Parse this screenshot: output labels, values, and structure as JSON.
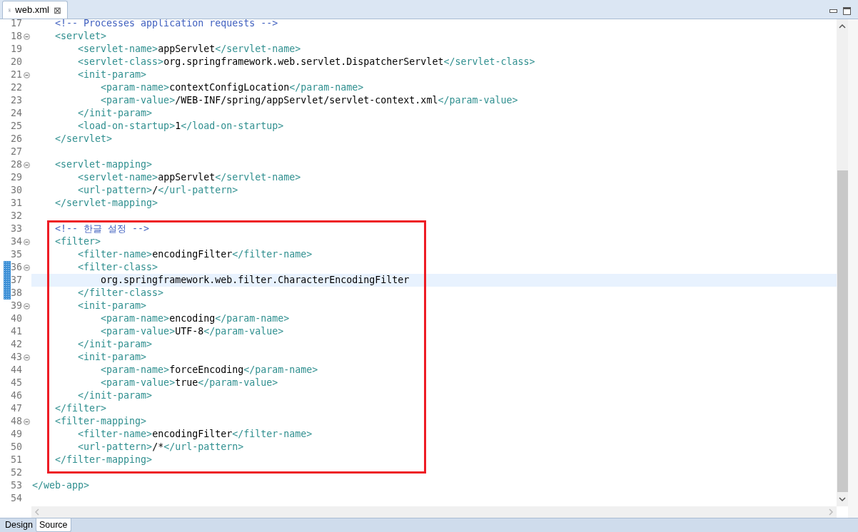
{
  "editor_tab": {
    "title": "web.xml",
    "close": "⊠"
  },
  "lines": [
    {
      "number": "17",
      "foldable": false,
      "changed": false,
      "current": false,
      "tokens": [
        {
          "kind": "comment",
          "text": "    <!-- Processes application requests -->"
        }
      ]
    },
    {
      "number": "18",
      "foldable": true,
      "changed": false,
      "current": false,
      "tokens": [
        {
          "kind": "tag",
          "text": "    <servlet>"
        }
      ]
    },
    {
      "number": "19",
      "foldable": false,
      "changed": false,
      "current": false,
      "tokens": [
        {
          "kind": "tag",
          "text": "        <servlet-name>"
        },
        {
          "kind": "text",
          "text": "appServlet"
        },
        {
          "kind": "tag",
          "text": "</servlet-name>"
        }
      ]
    },
    {
      "number": "20",
      "foldable": false,
      "changed": false,
      "current": false,
      "tokens": [
        {
          "kind": "tag",
          "text": "        <servlet-class>"
        },
        {
          "kind": "text",
          "text": "org.springframework.web.servlet.DispatcherServlet"
        },
        {
          "kind": "tag",
          "text": "</servlet-class>"
        }
      ]
    },
    {
      "number": "21",
      "foldable": true,
      "changed": false,
      "current": false,
      "tokens": [
        {
          "kind": "tag",
          "text": "        <init-param>"
        }
      ]
    },
    {
      "number": "22",
      "foldable": false,
      "changed": false,
      "current": false,
      "tokens": [
        {
          "kind": "tag",
          "text": "            <param-name>"
        },
        {
          "kind": "text",
          "text": "contextConfigLocation"
        },
        {
          "kind": "tag",
          "text": "</param-name>"
        }
      ]
    },
    {
      "number": "23",
      "foldable": false,
      "changed": false,
      "current": false,
      "tokens": [
        {
          "kind": "tag",
          "text": "            <param-value>"
        },
        {
          "kind": "text",
          "text": "/WEB-INF/spring/appServlet/servlet-context.xml"
        },
        {
          "kind": "tag",
          "text": "</param-value>"
        }
      ]
    },
    {
      "number": "24",
      "foldable": false,
      "changed": false,
      "current": false,
      "tokens": [
        {
          "kind": "tag",
          "text": "        </init-param>"
        }
      ]
    },
    {
      "number": "25",
      "foldable": false,
      "changed": false,
      "current": false,
      "tokens": [
        {
          "kind": "tag",
          "text": "        <load-on-startup>"
        },
        {
          "kind": "text",
          "text": "1"
        },
        {
          "kind": "tag",
          "text": "</load-on-startup>"
        }
      ]
    },
    {
      "number": "26",
      "foldable": false,
      "changed": false,
      "current": false,
      "tokens": [
        {
          "kind": "tag",
          "text": "    </servlet>"
        }
      ]
    },
    {
      "number": "27",
      "foldable": false,
      "changed": false,
      "current": false
    },
    {
      "number": "28",
      "foldable": true,
      "changed": false,
      "current": false,
      "tokens": [
        {
          "kind": "tag",
          "text": "    <servlet-mapping>"
        }
      ]
    },
    {
      "number": "29",
      "foldable": false,
      "changed": false,
      "current": false,
      "tokens": [
        {
          "kind": "tag",
          "text": "        <servlet-name>"
        },
        {
          "kind": "text",
          "text": "appServlet"
        },
        {
          "kind": "tag",
          "text": "</servlet-name>"
        }
      ]
    },
    {
      "number": "30",
      "foldable": false,
      "changed": false,
      "current": false,
      "tokens": [
        {
          "kind": "tag",
          "text": "        <url-pattern>"
        },
        {
          "kind": "text",
          "text": "/"
        },
        {
          "kind": "tag",
          "text": "</url-pattern>"
        }
      ]
    },
    {
      "number": "31",
      "foldable": false,
      "changed": false,
      "current": false,
      "tokens": [
        {
          "kind": "tag",
          "text": "    </servlet-mapping>"
        }
      ]
    },
    {
      "number": "32",
      "foldable": false,
      "changed": false,
      "current": false
    },
    {
      "number": "33",
      "foldable": false,
      "changed": false,
      "current": false,
      "tokens": [
        {
          "kind": "comment",
          "text": "    <!-- 한글 설정 -->"
        }
      ]
    },
    {
      "number": "34",
      "foldable": true,
      "changed": false,
      "current": false,
      "tokens": [
        {
          "kind": "tag",
          "text": "    <filter>"
        }
      ]
    },
    {
      "number": "35",
      "foldable": false,
      "changed": false,
      "current": false,
      "tokens": [
        {
          "kind": "tag",
          "text": "        <filter-name>"
        },
        {
          "kind": "text",
          "text": "encodingFilter"
        },
        {
          "kind": "tag",
          "text": "</filter-name>"
        }
      ]
    },
    {
      "number": "36",
      "foldable": true,
      "changed": true,
      "current": false,
      "tokens": [
        {
          "kind": "tag",
          "text": "        <filter-class>"
        }
      ]
    },
    {
      "number": "37",
      "foldable": false,
      "changed": true,
      "current": true,
      "tokens": [
        {
          "kind": "text",
          "text": "            org.springframework.web.filter.CharacterEncodingFilter"
        }
      ]
    },
    {
      "number": "38",
      "foldable": false,
      "changed": true,
      "current": false,
      "tokens": [
        {
          "kind": "tag",
          "text": "        </filter-class>"
        }
      ]
    },
    {
      "number": "39",
      "foldable": true,
      "changed": false,
      "current": false,
      "tokens": [
        {
          "kind": "tag",
          "text": "        <init-param>"
        }
      ]
    },
    {
      "number": "40",
      "foldable": false,
      "changed": false,
      "current": false,
      "tokens": [
        {
          "kind": "tag",
          "text": "            <param-name>"
        },
        {
          "kind": "text",
          "text": "encoding"
        },
        {
          "kind": "tag",
          "text": "</param-name>"
        }
      ]
    },
    {
      "number": "41",
      "foldable": false,
      "changed": false,
      "current": false,
      "tokens": [
        {
          "kind": "tag",
          "text": "            <param-value>"
        },
        {
          "kind": "text",
          "text": "UTF-8"
        },
        {
          "kind": "tag",
          "text": "</param-value>"
        }
      ]
    },
    {
      "number": "42",
      "foldable": false,
      "changed": false,
      "current": false,
      "tokens": [
        {
          "kind": "tag",
          "text": "        </init-param>"
        }
      ]
    },
    {
      "number": "43",
      "foldable": true,
      "changed": false,
      "current": false,
      "tokens": [
        {
          "kind": "tag",
          "text": "        <init-param>"
        }
      ]
    },
    {
      "number": "44",
      "foldable": false,
      "changed": false,
      "current": false,
      "tokens": [
        {
          "kind": "tag",
          "text": "            <param-name>"
        },
        {
          "kind": "text",
          "text": "forceEncoding"
        },
        {
          "kind": "tag",
          "text": "</param-name>"
        }
      ]
    },
    {
      "number": "45",
      "foldable": false,
      "changed": false,
      "current": false,
      "tokens": [
        {
          "kind": "tag",
          "text": "            <param-value>"
        },
        {
          "kind": "text",
          "text": "true"
        },
        {
          "kind": "tag",
          "text": "</param-value>"
        }
      ]
    },
    {
      "number": "46",
      "foldable": false,
      "changed": false,
      "current": false,
      "tokens": [
        {
          "kind": "tag",
          "text": "        </init-param>"
        }
      ]
    },
    {
      "number": "47",
      "foldable": false,
      "changed": false,
      "current": false,
      "tokens": [
        {
          "kind": "tag",
          "text": "    </filter>"
        }
      ]
    },
    {
      "number": "48",
      "foldable": true,
      "changed": false,
      "current": false,
      "tokens": [
        {
          "kind": "tag",
          "text": "    <filter-mapping>"
        }
      ]
    },
    {
      "number": "49",
      "foldable": false,
      "changed": false,
      "current": false,
      "tokens": [
        {
          "kind": "tag",
          "text": "        <filter-name>"
        },
        {
          "kind": "text",
          "text": "encodingFilter"
        },
        {
          "kind": "tag",
          "text": "</filter-name>"
        }
      ]
    },
    {
      "number": "50",
      "foldable": false,
      "changed": false,
      "current": false,
      "tokens": [
        {
          "kind": "tag",
          "text": "        <url-pattern>"
        },
        {
          "kind": "text",
          "text": "/*"
        },
        {
          "kind": "tag",
          "text": "</url-pattern>"
        }
      ]
    },
    {
      "number": "51",
      "foldable": false,
      "changed": false,
      "current": false,
      "tokens": [
        {
          "kind": "tag",
          "text": "    </filter-mapping>"
        }
      ]
    },
    {
      "number": "52",
      "foldable": false,
      "changed": false,
      "current": false
    },
    {
      "number": "53",
      "foldable": false,
      "changed": false,
      "current": false,
      "tokens": [
        {
          "kind": "tag",
          "text": "</web-app>"
        }
      ]
    },
    {
      "number": "54",
      "foldable": false,
      "changed": false,
      "current": false
    }
  ],
  "view_tabs": [
    {
      "label": "Design",
      "selected": false
    },
    {
      "label": "Source",
      "selected": true
    }
  ]
}
